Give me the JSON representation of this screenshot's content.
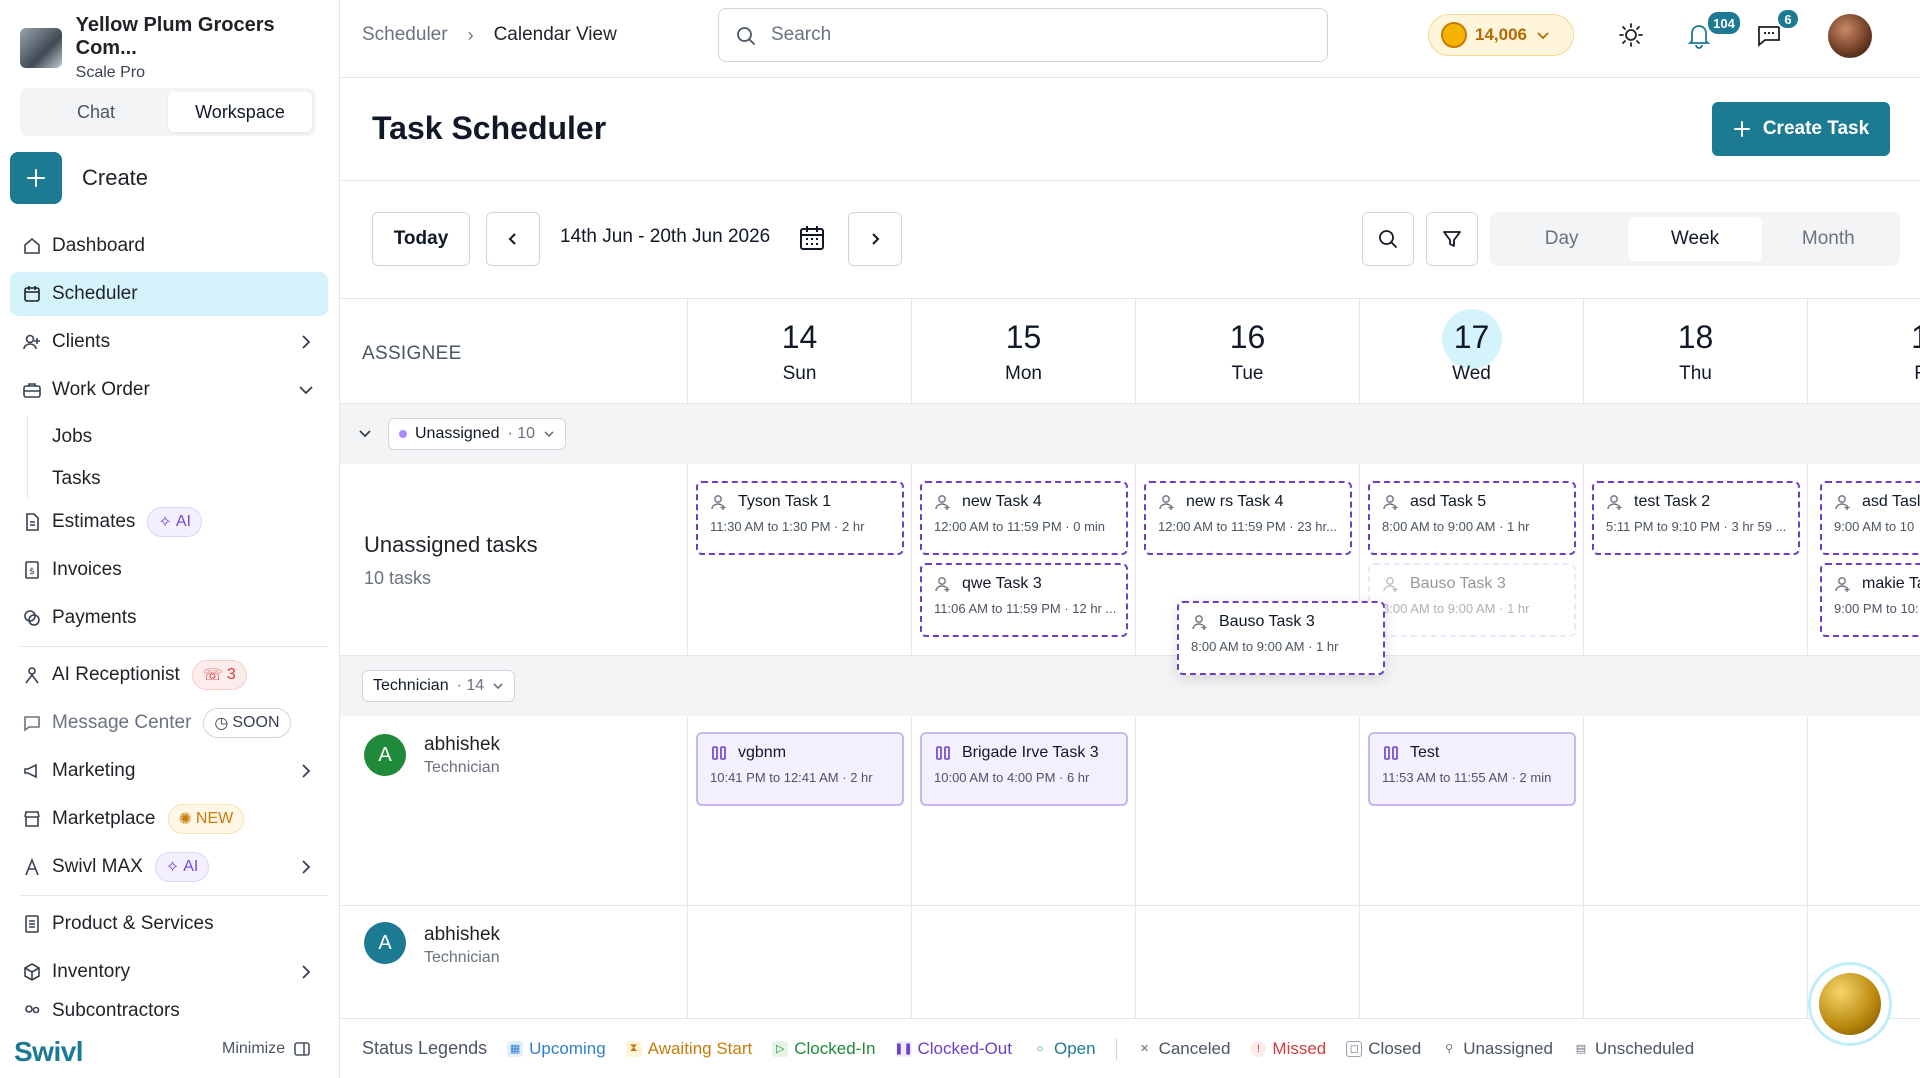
{
  "org": {
    "name": "Yellow Plum Grocers Com...",
    "plan": "Scale Pro"
  },
  "sidebar": {
    "tabs": [
      "Chat",
      "Workspace"
    ],
    "active_tab": "Workspace",
    "create_label": "Create",
    "items": [
      {
        "label": "Dashboard"
      },
      {
        "label": "Scheduler",
        "active": true
      },
      {
        "label": "Clients"
      },
      {
        "label": "Work Order"
      },
      {
        "label": "Jobs"
      },
      {
        "label": "Tasks"
      },
      {
        "label": "Estimates",
        "pill": "AI"
      },
      {
        "label": "Invoices"
      },
      {
        "label": "Payments"
      },
      {
        "label": "AI Receptionist",
        "pill": "3"
      },
      {
        "label": "Message Center",
        "pill": "SOON"
      },
      {
        "label": "Marketing"
      },
      {
        "label": "Marketplace",
        "pill": "NEW"
      },
      {
        "label": "Swivl MAX",
        "pill": "AI"
      },
      {
        "label": "Product & Services"
      },
      {
        "label": "Inventory"
      },
      {
        "label": "Subcontractors"
      }
    ],
    "brand": "Swivl",
    "minimize_label": "Minimize"
  },
  "topbar": {
    "breadcrumb": [
      "Scheduler",
      "Calendar View"
    ],
    "search_placeholder": "Search",
    "coins": "14,006",
    "notifications_count": "104",
    "messages_count": "6"
  },
  "header": {
    "title": "Task Scheduler",
    "create_task_label": "Create Task"
  },
  "toolbar": {
    "today_label": "Today",
    "date_range": "14th Jun - 20th Jun 2026",
    "views": [
      "Day",
      "Week",
      "Month"
    ],
    "active_view": "Week"
  },
  "grid": {
    "assignee_header": "ASSIGNEE",
    "days": [
      {
        "num": "14",
        "dow": "Sun"
      },
      {
        "num": "15",
        "dow": "Mon"
      },
      {
        "num": "16",
        "dow": "Tue"
      },
      {
        "num": "17",
        "dow": "Wed",
        "today": true
      },
      {
        "num": "18",
        "dow": "Thu"
      },
      {
        "num": "1",
        "dow": "F"
      }
    ],
    "unassigned_group": {
      "label": "Unassigned",
      "count": "· 10"
    },
    "unassigned_row": {
      "title": "Unassigned tasks",
      "subtitle": "10 tasks"
    },
    "technician_group": {
      "label": "Technician",
      "count": "· 14"
    },
    "technicians": [
      {
        "initial": "A",
        "name": "abhishek",
        "role": "Technician",
        "color": "#1f8a3a"
      },
      {
        "initial": "A",
        "name": "abhishek",
        "role": "Technician",
        "color": "#1d7a93"
      }
    ]
  },
  "tasks": {
    "unassigned": [
      {
        "name": "Tyson Task 1",
        "time": "11:30 AM to 1:30 PM · 2 hr"
      },
      {
        "name": "new Task 4",
        "time": "12:00 AM to 11:59 PM · 0 min"
      },
      {
        "name": "qwe Task 3",
        "time": "11:06 AM to 11:59 PM · 12 hr ..."
      },
      {
        "name": "new rs Task 4",
        "time": "12:00 AM to 11:59 PM · 23 hr..."
      },
      {
        "name": "asd Task 5",
        "time": "8:00 AM to 9:00 AM · 1 hr"
      },
      {
        "name": "Bauso Task 3",
        "time": "8:00 AM to 9:00 AM · 1 hr"
      },
      {
        "name": "test Task 2",
        "time": "5:11 PM to 9:10 PM · 3 hr 59 ..."
      },
      {
        "name": "asd Tasl",
        "time": "9:00 AM to 10"
      },
      {
        "name": "makie Ta",
        "time": "9:00 PM to 10:"
      },
      {
        "name": "Bauso Task 3",
        "time": "8:00 AM to 9:00 AM · 1 hr"
      }
    ],
    "technician": [
      {
        "name": "vgbnm",
        "time": "10:41 PM to 12:41 AM · 2 hr"
      },
      {
        "name": "Brigade Irve Task 3",
        "time": "10:00 AM to 4:00 PM · 6 hr"
      },
      {
        "name": "Test",
        "time": "11:53 AM to 11:55 AM · 2 min"
      }
    ]
  },
  "legend": {
    "title": "Status Legends",
    "items": [
      {
        "label": "Upcoming",
        "color": "#2f7fcf"
      },
      {
        "label": "Awaiting Start",
        "color": "#c77c09"
      },
      {
        "label": "Clocked-In",
        "color": "#1f8a3a"
      },
      {
        "label": "Clocked-Out",
        "color": "#6d3fc8"
      },
      {
        "label": "Open",
        "color": "#1d7a93"
      },
      {
        "label": "Canceled",
        "color": "#4b5563"
      },
      {
        "label": "Missed",
        "color": "#d23b3b"
      },
      {
        "label": "Closed",
        "color": "#4b5563"
      },
      {
        "label": "Unassigned",
        "color": "#4b5563"
      },
      {
        "label": "Unscheduled",
        "color": "#4b5563"
      }
    ]
  }
}
